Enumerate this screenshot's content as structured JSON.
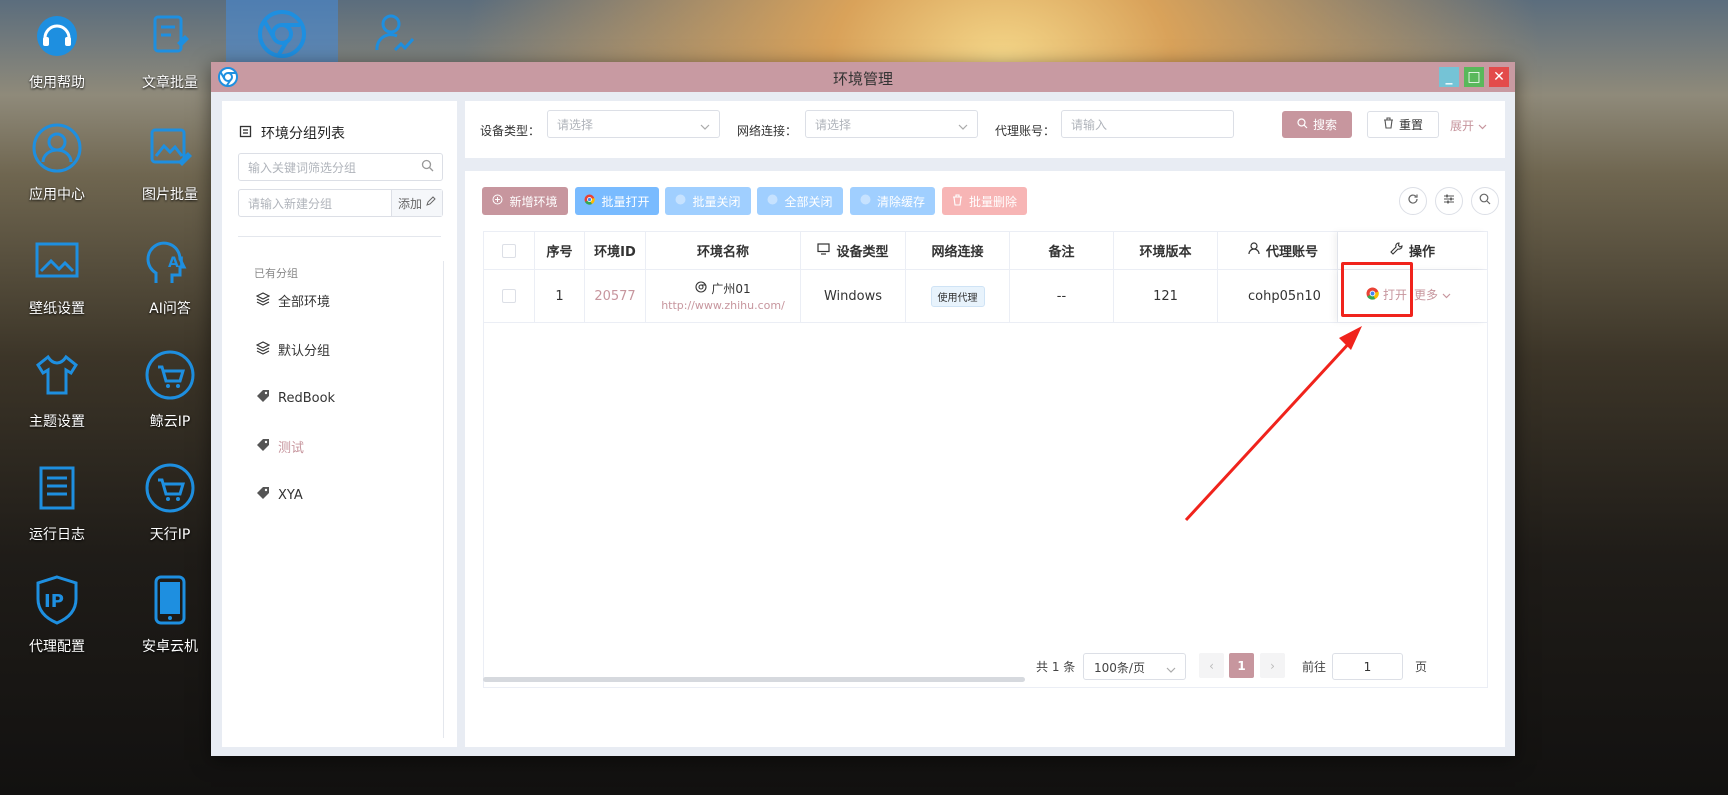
{
  "desktop": {
    "icons": [
      {
        "label": "使用帮助",
        "icon": "headset-icon"
      },
      {
        "label": "文章批量",
        "icon": "article-edit-icon"
      },
      {
        "label": "应用中心",
        "icon": "user-circle-icon"
      },
      {
        "label": "图片批量",
        "icon": "image-edit-icon"
      },
      {
        "label": "壁纸设置",
        "icon": "wallpaper-icon"
      },
      {
        "label": "AI问答",
        "icon": "ai-head-icon"
      },
      {
        "label": "主题设置",
        "icon": "tshirt-icon"
      },
      {
        "label": "鲸云IP",
        "icon": "cart-circle-icon"
      },
      {
        "label": "运行日志",
        "icon": "log-document-icon"
      },
      {
        "label": "天行IP",
        "icon": "cart-circle-icon"
      },
      {
        "label": "代理配置",
        "icon": "ip-shield-icon"
      },
      {
        "label": "安卓云机",
        "icon": "phone-icon"
      }
    ],
    "top_icons": [
      "chrome-icon",
      "user-chart-icon"
    ]
  },
  "window": {
    "title": "环境管理",
    "controls": {
      "minimize": "_",
      "maximize": "□",
      "close": "✕"
    }
  },
  "group_panel": {
    "title": "环境分组列表",
    "search_placeholder": "输入关键词筛选分组",
    "new_group_placeholder": "请输入新建分组",
    "add_label": "添加",
    "section_label": "已有分组",
    "groups": [
      {
        "label": "全部环境",
        "icon": "layers-icon",
        "active": false
      },
      {
        "label": "默认分组",
        "icon": "layers-icon",
        "active": false
      },
      {
        "label": "RedBook",
        "icon": "tag-icon",
        "active": false
      },
      {
        "label": "测试",
        "icon": "tag-icon",
        "active": true
      },
      {
        "label": "XYA",
        "icon": "tag-icon",
        "active": false
      }
    ]
  },
  "filters": {
    "device_type_label": "设备类型：",
    "device_type_placeholder": "请选择",
    "network_label": "网络连接：",
    "network_placeholder": "请选择",
    "proxy_account_label": "代理账号：",
    "proxy_account_placeholder": "请输入",
    "search_label": "搜索",
    "reset_label": "重置",
    "expand_label": "展开"
  },
  "toolbar": {
    "new_env": "新增环境",
    "batch_open": "批量打开",
    "batch_close": "批量关闭",
    "close_all": "全部关闭",
    "clear_cache": "清除缓存",
    "batch_delete": "批量删除"
  },
  "table": {
    "headers": {
      "index": "序号",
      "env_id": "环境ID",
      "env_name": "环境名称",
      "device_type": "设备类型",
      "network": "网络连接",
      "remark": "备注",
      "version": "环境版本",
      "proxy_account": "代理账号",
      "actions": "操作"
    },
    "rows": [
      {
        "index": "1",
        "env_id": "20577",
        "env_name": "广州01",
        "env_url": "http://www.zhihu.com/",
        "device_type": "Windows",
        "network": "使用代理",
        "remark": "--",
        "version": "121",
        "proxy_account": "cohp05n10",
        "open_label": "打开",
        "more_label": "更多"
      }
    ]
  },
  "pagination": {
    "total_text": "共 1 条",
    "page_size": "100条/页",
    "current_page": "1",
    "goto_label": "前往",
    "goto_value": "1",
    "page_suffix": "页"
  },
  "colors": {
    "accent": "#c7969e",
    "titlebar": "#c89aa2",
    "batch_blue": "#a0cfff",
    "danger_light": "#f7b5b5",
    "highlight_red": "#f0231c"
  }
}
